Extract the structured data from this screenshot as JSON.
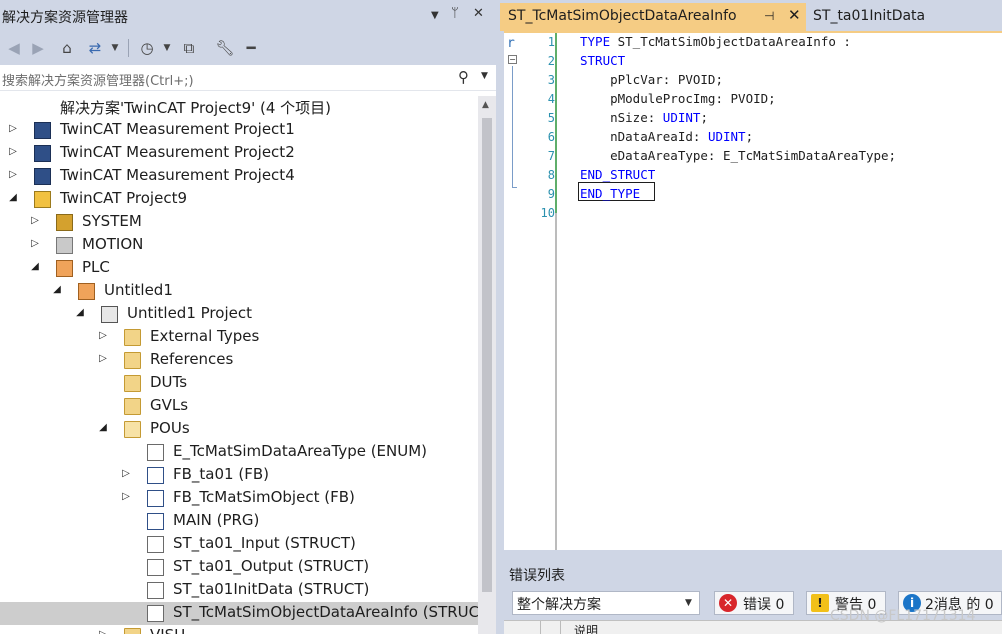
{
  "solution_explorer": {
    "title": "解决方案资源管理器",
    "title_buttons": [
      "▼",
      "ᛘ",
      "✕"
    ],
    "search_placeholder": "搜索解决方案资源管理器(Ctrl+;)",
    "tree": [
      {
        "label": "解决方案'TwinCAT Project9' (4 个项目)",
        "depth": 0,
        "expander": "",
        "icon": "visual-studio-solution-icon"
      },
      {
        "label": "TwinCAT Measurement Project1",
        "depth": 0,
        "expander": "collapsed",
        "icon": "measurement-project-icon"
      },
      {
        "label": "TwinCAT Measurement Project2",
        "depth": 0,
        "expander": "collapsed",
        "icon": "measurement-project-icon"
      },
      {
        "label": "TwinCAT Measurement Project4",
        "depth": 0,
        "expander": "collapsed",
        "icon": "measurement-project-icon"
      },
      {
        "label": "TwinCAT Project9",
        "depth": 0,
        "expander": "expanded",
        "icon": "twincat-project-icon"
      },
      {
        "label": "SYSTEM",
        "depth": 1,
        "expander": "collapsed",
        "icon": "system-icon"
      },
      {
        "label": "MOTION",
        "depth": 1,
        "expander": "collapsed",
        "icon": "motion-icon"
      },
      {
        "label": "PLC",
        "depth": 1,
        "expander": "expanded",
        "icon": "plc-icon"
      },
      {
        "label": "Untitled1",
        "depth": 2,
        "expander": "expanded",
        "icon": "plc-project-icon"
      },
      {
        "label": "Untitled1 Project",
        "depth": 3,
        "expander": "expanded",
        "icon": "plc-subproject-icon"
      },
      {
        "label": "External Types",
        "depth": 4,
        "expander": "collapsed",
        "icon": "folder-icon"
      },
      {
        "label": "References",
        "depth": 4,
        "expander": "collapsed",
        "icon": "references-icon"
      },
      {
        "label": "DUTs",
        "depth": 4,
        "expander": "",
        "icon": "folder-icon"
      },
      {
        "label": "GVLs",
        "depth": 4,
        "expander": "",
        "icon": "folder-icon"
      },
      {
        "label": "POUs",
        "depth": 4,
        "expander": "expanded",
        "icon": "folder-open-icon"
      },
      {
        "label": "E_TcMatSimDataAreaType (ENUM)",
        "depth": 5,
        "expander": "",
        "icon": "dut-icon"
      },
      {
        "label": "FB_ta01 (FB)",
        "depth": 5,
        "expander": "collapsed",
        "icon": "function-block-icon"
      },
      {
        "label": "FB_TcMatSimObject (FB)",
        "depth": 5,
        "expander": "collapsed",
        "icon": "function-block-icon"
      },
      {
        "label": "MAIN (PRG)",
        "depth": 5,
        "expander": "",
        "icon": "program-icon"
      },
      {
        "label": "ST_ta01_Input (STRUCT)",
        "depth": 5,
        "expander": "",
        "icon": "dut-icon"
      },
      {
        "label": "ST_ta01_Output (STRUCT)",
        "depth": 5,
        "expander": "",
        "icon": "dut-icon"
      },
      {
        "label": "ST_ta01InitData (STRUCT)",
        "depth": 5,
        "expander": "",
        "icon": "dut-icon"
      },
      {
        "label": "ST_TcMatSimObjectDataAreaInfo (STRUC",
        "depth": 5,
        "expander": "",
        "icon": "dut-icon",
        "selected": true
      },
      {
        "label": "VISU",
        "depth": 4,
        "expander": "collapsed",
        "icon": "folder-icon"
      }
    ]
  },
  "editor": {
    "active_tab": "ST_TcMatSimObjectDataAreaInfo",
    "active_tab_pin": "⊣",
    "active_tab_close": "✕",
    "second_tab": "ST_ta01InitData",
    "gutter_mark": "r",
    "lines": [
      {
        "n": "1",
        "parts": [
          {
            "t": "TYPE",
            "k": true
          },
          {
            "t": " ST_TcMatSimObjectDataAreaInfo :",
            "k": false
          }
        ]
      },
      {
        "n": "2",
        "parts": [
          {
            "t": "STRUCT",
            "k": true
          }
        ]
      },
      {
        "n": "3",
        "parts": [
          {
            "t": "    pPlcVar: PVOID;",
            "k": false
          }
        ]
      },
      {
        "n": "4",
        "parts": [
          {
            "t": "    pModuleProcImg: PVOID;",
            "k": false
          }
        ]
      },
      {
        "n": "5",
        "parts": [
          {
            "t": "    nSize: ",
            "k": false
          },
          {
            "t": "UDINT",
            "k": true
          },
          {
            "t": ";",
            "k": false
          }
        ]
      },
      {
        "n": "6",
        "parts": [
          {
            "t": "    nDataAreaId: ",
            "k": false
          },
          {
            "t": "UDINT",
            "k": true
          },
          {
            "t": ";",
            "k": false
          }
        ]
      },
      {
        "n": "7",
        "parts": [
          {
            "t": "    eDataAreaType: E_TcMatSimDataAreaType;",
            "k": false
          }
        ]
      },
      {
        "n": "8",
        "parts": [
          {
            "t": "END_STRUCT",
            "k": true
          }
        ]
      },
      {
        "n": "9",
        "parts": [
          {
            "t": "END_TYPE",
            "k": true
          }
        ]
      },
      {
        "n": "10",
        "parts": []
      }
    ]
  },
  "error_list": {
    "title": "错误列表",
    "scope": "整个解决方案",
    "errors_label": "错误 0",
    "warnings_label": "警告 0",
    "messages_label": "2消息 的 0",
    "column_desc": "说明"
  },
  "watermark": "CSDN @FL17171314"
}
